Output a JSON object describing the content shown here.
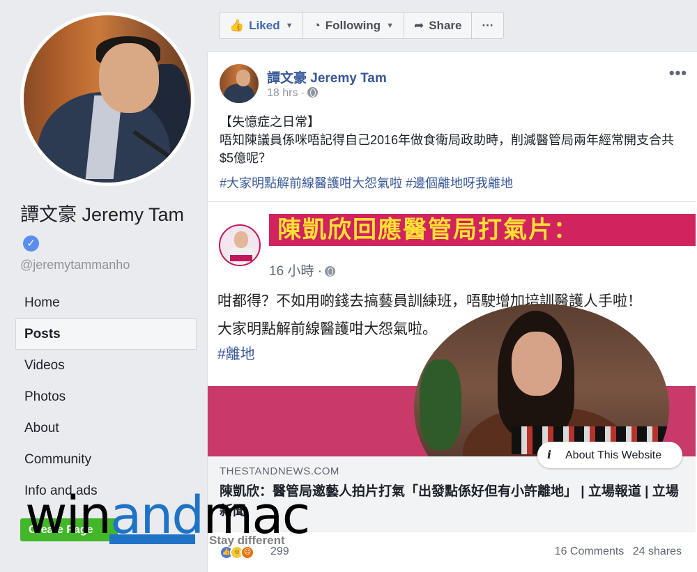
{
  "page": {
    "name": "譚文豪 Jeremy Tam",
    "handle": "@jeremytammanho"
  },
  "nav": {
    "items": [
      "Home",
      "Posts",
      "Videos",
      "Photos",
      "About",
      "Community",
      "Info and ads"
    ],
    "active_index": 1,
    "create_page": "Create Page"
  },
  "actions": {
    "liked": "Liked",
    "following": "Following",
    "share": "Share",
    "more": "···"
  },
  "post": {
    "author": "譚文豪 Jeremy Tam",
    "time": "18 hrs",
    "line1": "【失憶症之日常】",
    "line2": "唔知陳議員係咪唔記得自己2016年做食衛局政助時，削減醫管局兩年經常開支合共$5億呢？",
    "tags": "#大家明點解前線醫護咁大怨氣啦 #邊個離地呀我離地"
  },
  "shared_image": {
    "banner": "陳凱欣回應醫管局打氣片：",
    "time": "16 小時",
    "text1": "咁都得？不如用啲錢去搞藝員訓練班，唔駛增加培訓醫護人手啦！",
    "text2": "大家明點解前線醫護咁大怨氣啦。",
    "tag": "#離地"
  },
  "about_site": "About This Website",
  "link": {
    "domain": "THESTANDNEWS.COM",
    "title": "陳凱欣：醫管局邀藝人拍片打氣「出發點係好但有小許離地」 | 立場報道 | 立場新聞"
  },
  "reactions": {
    "count": "299",
    "comments": "16 Comments",
    "shares": "24 shares"
  },
  "watermark": {
    "part1": "win",
    "part2": "and",
    "part3": "mac",
    "tagline": "Stay different"
  },
  "colors": {
    "link_blue": "#385898",
    "banner_pink": "#d1245e",
    "banner_text": "#ffe033",
    "create_green": "#42b72a",
    "watermark_blue": "#1f73c6"
  }
}
